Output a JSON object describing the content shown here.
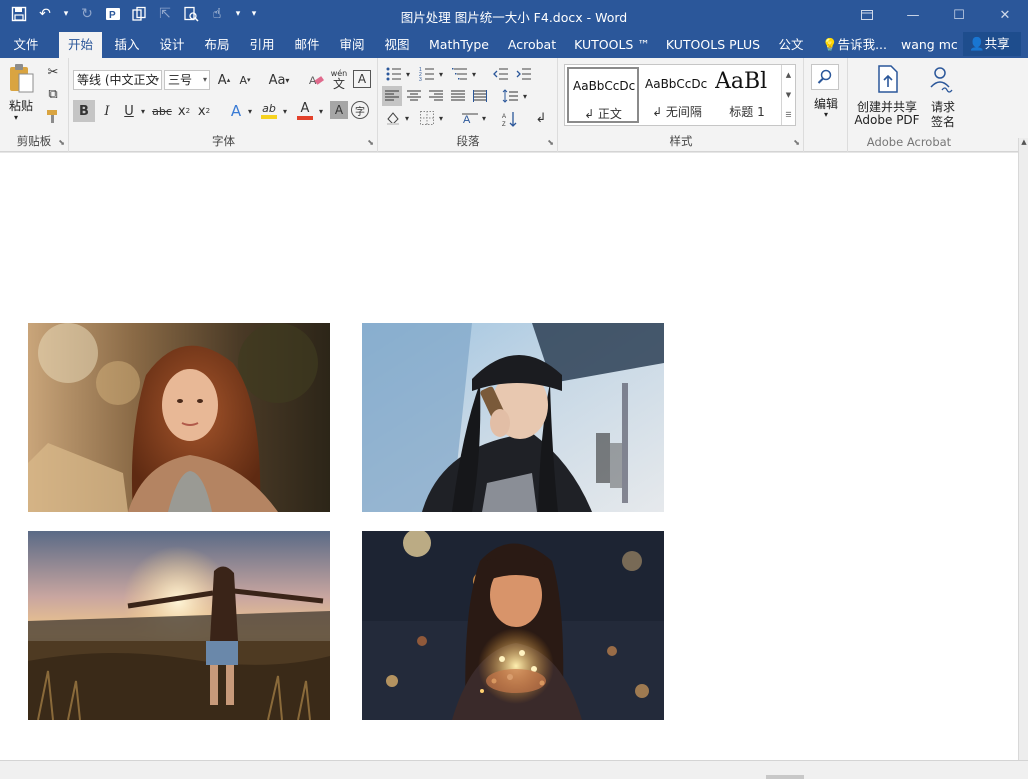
{
  "window": {
    "title": "图片处理 图片统一大小 F4.docx - Word"
  },
  "ribbon_tabs": [
    {
      "label": "文件"
    },
    {
      "label": "开始"
    },
    {
      "label": "插入"
    },
    {
      "label": "设计"
    },
    {
      "label": "布局"
    },
    {
      "label": "引用"
    },
    {
      "label": "邮件"
    },
    {
      "label": "审阅"
    },
    {
      "label": "视图"
    },
    {
      "label": "MathType"
    },
    {
      "label": "Acrobat"
    },
    {
      "label": "KUTOOLS ™"
    },
    {
      "label": "KUTOOLS PLUS"
    },
    {
      "label": "公文"
    }
  ],
  "active_tab": "开始",
  "tell_me": "告诉我...",
  "user_name": "wang mc",
  "share_label": "共享",
  "clipboard": {
    "paste_label": "粘贴",
    "group_label": "剪贴板"
  },
  "font": {
    "name": "等线 (中文正文",
    "size": "三号",
    "grow": "A",
    "shrink": "A",
    "case": "Aa",
    "phonetic": "wén",
    "phonetic_char": "文",
    "border_char": "A",
    "bold": "B",
    "italic": "I",
    "underline": "U",
    "strike": "abc",
    "sub": "x",
    "sup": "x",
    "effects": "A",
    "highlight": "ab",
    "color": "A",
    "shade": "A",
    "enclose": "字",
    "group_label": "字体"
  },
  "paragraph": {
    "group_label": "段落"
  },
  "styles": {
    "items": [
      {
        "sample": "AaBbCcDc",
        "name": "↲ 正文"
      },
      {
        "sample": "AaBbCcDc",
        "name": "↲ 无间隔"
      },
      {
        "sample": "AaBl",
        "name": "标题 1"
      }
    ],
    "group_label": "样式"
  },
  "editing": {
    "label": "编辑"
  },
  "acrobat": {
    "create_line1": "创建并共享",
    "create_line2": "Adobe PDF",
    "sign_line1": "请求",
    "sign_line2": "签名",
    "group_label": "Adobe Acrobat"
  },
  "document": {
    "images": [
      {
        "name": "woman-autumn-portrait"
      },
      {
        "name": "woman-phone-street"
      },
      {
        "name": "woman-sunset-field"
      },
      {
        "name": "woman-fairy-lights"
      }
    ]
  },
  "colors": {
    "word_blue": "#2b579a",
    "ribbon_bg": "#f3f3f3",
    "font_color_bar": "#e3412b",
    "highlight_bar": "#f6d21f"
  }
}
